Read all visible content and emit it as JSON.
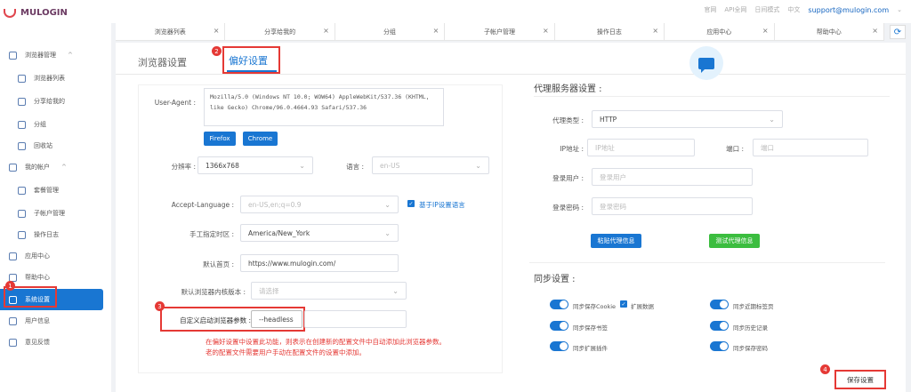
{
  "brand": {
    "name": "MULOGIN"
  },
  "top_links": {
    "home": "官网",
    "api": "API全网",
    "light": "日间模式",
    "lang": "中文",
    "email": "support@mulogin.com"
  },
  "sidebar": {
    "items": [
      {
        "label": "浏览器管理",
        "caret": "^"
      },
      {
        "label": "浏览器列表"
      },
      {
        "label": "分享给我的"
      },
      {
        "label": "分组"
      },
      {
        "label": "回收站"
      },
      {
        "label": "我的帐户",
        "caret": "^"
      },
      {
        "label": "套餐管理"
      },
      {
        "label": "子帐户管理"
      },
      {
        "label": "操作日志"
      },
      {
        "label": "应用中心"
      },
      {
        "label": "帮助中心"
      },
      {
        "label": "系统设置"
      },
      {
        "label": "用户信息"
      },
      {
        "label": "意见反馈"
      }
    ]
  },
  "tabs": [
    "浏览器列表",
    "分享给我的",
    "分组",
    "子帐户管理",
    "操作日志",
    "应用中心",
    "帮助中心"
  ],
  "page_tabs": {
    "browser": "浏览器设置",
    "pref": "偏好设置"
  },
  "markers": {
    "m1": "1",
    "m2": "2",
    "m3": "3",
    "m4": "4"
  },
  "form": {
    "ua_label": "User-Agent :",
    "ua_value": "Mozilla/5.0 (Windows NT 10.0; WOW64) AppleWebKit/537.36 (KHTML, like Gecko) Chrome/96.0.4664.93 Safari/537.36",
    "btn_firefox": "Firefox",
    "btn_chrome": "Chrome",
    "res_label": "分辨率 :",
    "res_value": "1366x768",
    "lang_label": "语言 :",
    "lang_value": "en-US",
    "accept_label": "Accept-Language :",
    "accept_value": "en-US,en;q=0.9",
    "ip_lang": "基于IP设置语言",
    "tz_label": "手工指定时区 :",
    "tz_value": "America/New_York",
    "home_label": "默认首页 :",
    "home_value": "https://www.mulogin.com/",
    "kernel_label": "默认浏览器内核版本 :",
    "kernel_placeholder": "请选择",
    "custom_label": "自定义启动浏览器参数 :",
    "custom_value": "--headless",
    "note1": "在偏好设置中设置此功能，则表示在创建新的配置文件中自动添加此浏览器参数。",
    "note2": "老的配置文件需要用户手动在配置文件的设置中添加。"
  },
  "proxy": {
    "title": "代理服务器设置 :",
    "type_label": "代理类型 :",
    "type_value": "HTTP",
    "ip_label": "IP地址 :",
    "ip_placeholder": "IP地址",
    "port_label": "端口 :",
    "port_placeholder": "端口",
    "user_label": "登录用户 :",
    "user_placeholder": "登录用户",
    "pass_label": "登录密码 :",
    "pass_placeholder": "登录密码",
    "btn_paste": "粘贴代理信息",
    "btn_test": "测试代理信息"
  },
  "sync": {
    "title": "同步设置 :",
    "items": [
      "同步保存Cookie",
      "扩展数据",
      "同步近期标签页",
      "同步保存书签",
      "同步历史记录",
      "同步扩展插件",
      "同步保存密码"
    ]
  },
  "save": "保存设置"
}
